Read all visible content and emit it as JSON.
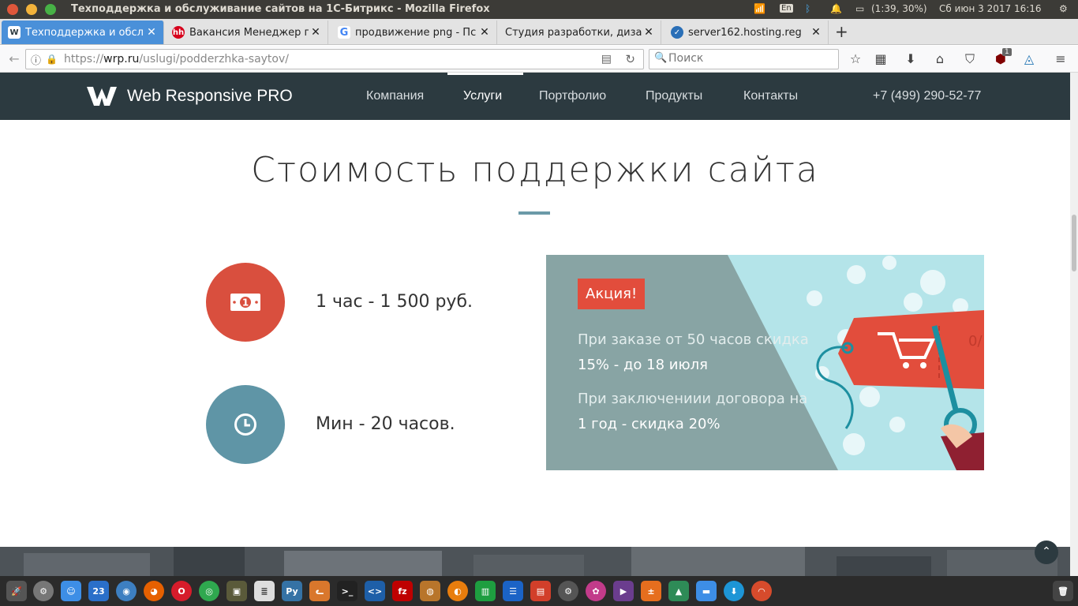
{
  "os": {
    "window_title": "Техподдержка и обслуживание сайтов на 1С-Битрикс - Mozilla Firefox",
    "lang": "En",
    "battery": "(1:39, 30%)",
    "clock": "Сб июн  3 2017 16:16"
  },
  "browser": {
    "tabs": [
      {
        "label": "Техподдержка и обсл",
        "favicon": "W",
        "favicon_color": "#4a90d9",
        "active": true
      },
      {
        "label": "Вакансия Менеджер п",
        "favicon": "hh",
        "favicon_color": "#d6001c",
        "active": false
      },
      {
        "label": "продвижение png - Пс",
        "favicon": "G",
        "favicon_color": "#4285f4",
        "active": false
      },
      {
        "label": "Студия разработки, диза",
        "favicon": "",
        "favicon_color": "#e3e3e3",
        "active": false
      },
      {
        "label": "server162.hosting.reg",
        "favicon": "✓",
        "favicon_color": "#2a6fb7",
        "active": false
      }
    ],
    "new_tab": "+",
    "url_prefix": "https://",
    "url_host": "wrp.ru",
    "url_path": "/uslugi/podderzhka-saytov/",
    "search_placeholder": "Поиск",
    "ublock_count": "1"
  },
  "site": {
    "logo": "Web Responsive PRO",
    "nav": [
      "Компания",
      "Услуги",
      "Портфолио",
      "Продукты",
      "Контакты"
    ],
    "active_nav": "Услуги",
    "phone": "+7 (499) 290-52-77",
    "heading": "Стоимость поддержки сайта",
    "price_items": [
      {
        "text": "1 час - 1 500 руб.",
        "icon": "money-icon",
        "color": "#d94f3e"
      },
      {
        "text": "Мин - 20 часов.",
        "icon": "clock-icon",
        "color": "#5f95a6"
      }
    ],
    "promo": {
      "badge": "Акция!",
      "line1": "При заказе от 50 часов скидка",
      "line2": "15% - до 18 июля",
      "line3": "При заключениии договора на",
      "line4": "1 год - скидка 20%"
    }
  },
  "dock": {
    "calendar_day": "23",
    "apps": [
      "launcher-icon",
      "settings-icon",
      "finder-icon",
      "calendar-icon",
      "browser-icon",
      "firefox-icon",
      "opera-icon",
      "chrome-icon",
      "app-icon",
      "document-icon",
      "python-icon",
      "cat-icon",
      "terminal-icon",
      "code-icon",
      "filezilla-icon",
      "gimp-icon",
      "blender-icon",
      "spreadsheet-icon",
      "text-icon",
      "presentation-icon",
      "system-icon",
      "photos-icon",
      "media-icon",
      "calculator-icon",
      "chart-icon",
      "folder-icon",
      "download-icon",
      "rss-icon"
    ],
    "trash": "trash-icon"
  }
}
